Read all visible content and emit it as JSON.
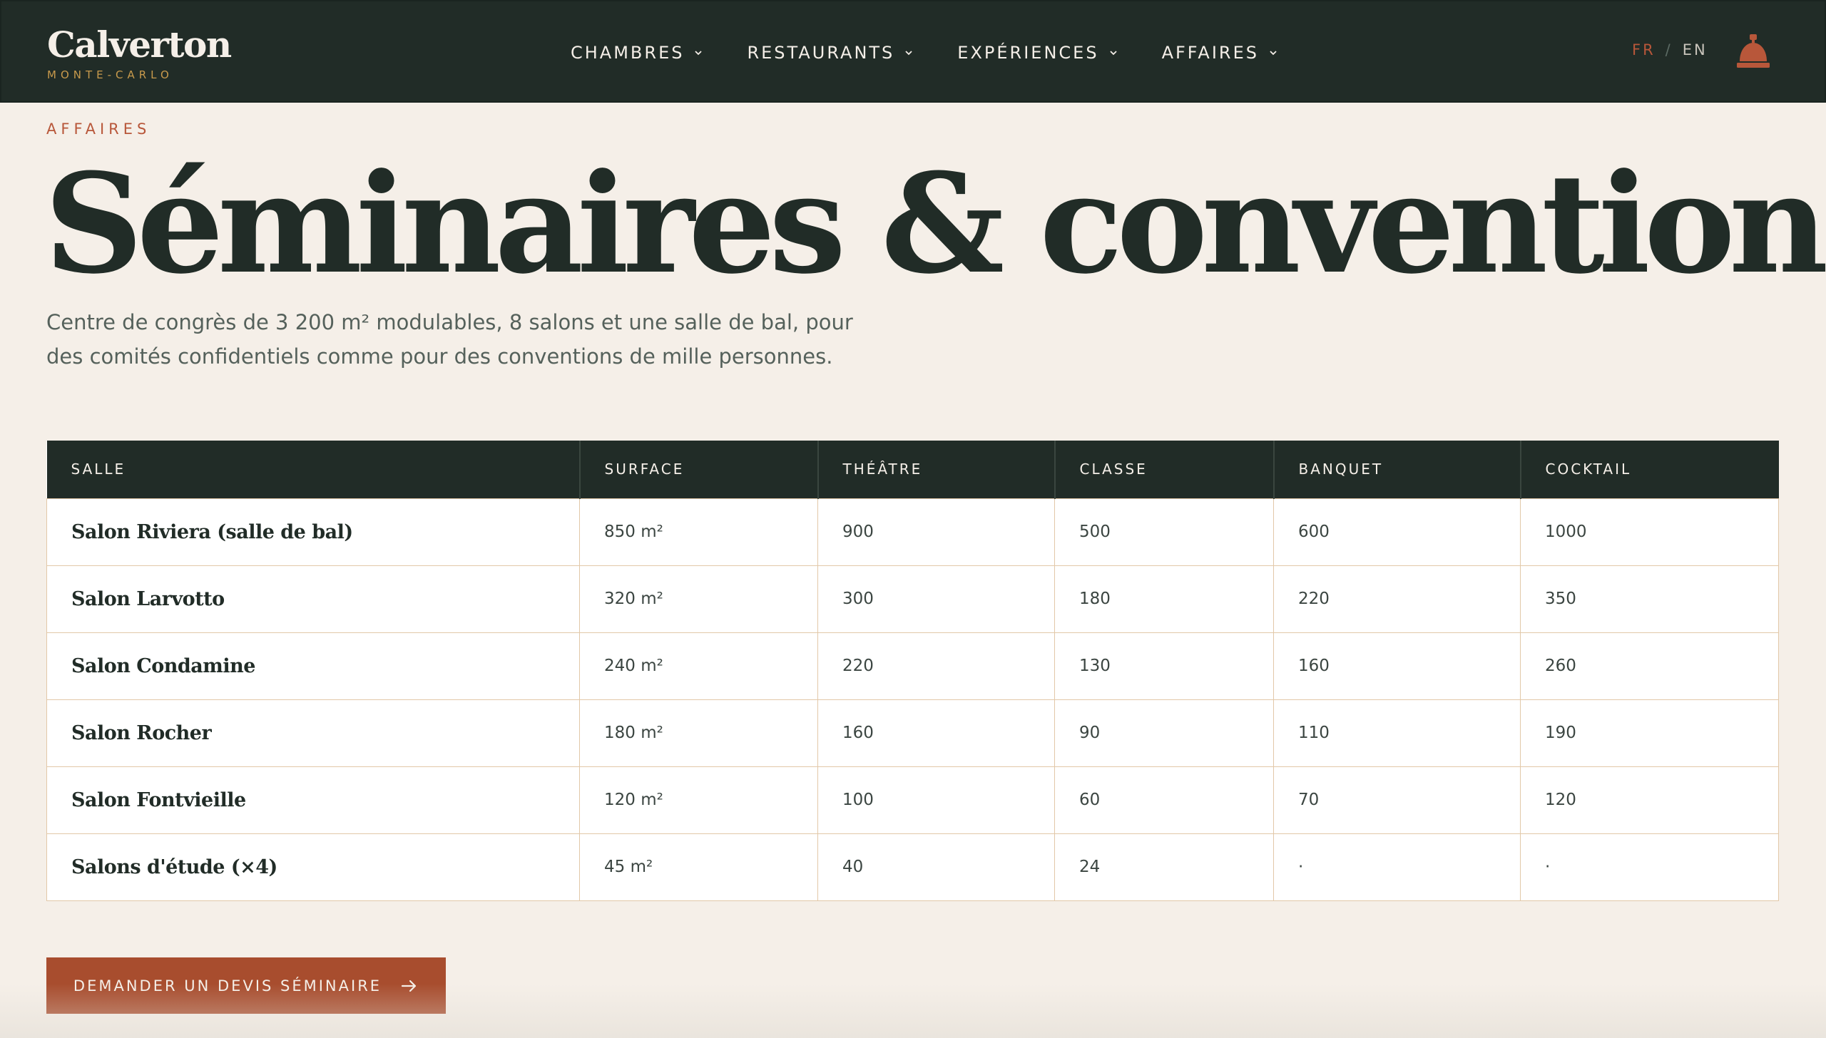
{
  "brand": {
    "name": "Calverton",
    "subtitle": "MONTE-CARLO"
  },
  "nav": {
    "items": [
      {
        "label": "CHAMBRES"
      },
      {
        "label": "RESTAURANTS"
      },
      {
        "label": "EXPÉRIENCES"
      },
      {
        "label": "AFFAIRES"
      }
    ],
    "chevron_icon": "chevron-down-icon"
  },
  "language": {
    "fr": "FR",
    "separator": "/",
    "en": "EN",
    "active": "FR"
  },
  "concierge_icon": "reception-bell-icon",
  "colors": {
    "header_bg": "#212c27",
    "page_bg": "#f5efe8",
    "accent": "#b8573a",
    "gold": "#c89a4c",
    "cta_bg": "#a84d2e",
    "table_border": "#e2c8a8"
  },
  "hero": {
    "eyebrow": "AFFAIRES",
    "title": "Séminaires & conventions",
    "lead": "Centre de congrès de 3 200 m² modulables, 8 salons et une salle de bal, pour des comités confidentiels comme pour des conventions de mille personnes."
  },
  "table": {
    "headers": [
      "SALLE",
      "SURFACE",
      "THÉÂTRE",
      "CLASSE",
      "BANQUET",
      "COCKTAIL"
    ],
    "rows": [
      [
        "Salon Riviera (salle de bal)",
        "850 m²",
        "900",
        "500",
        "600",
        "1000"
      ],
      [
        "Salon Larvotto",
        "320 m²",
        "300",
        "180",
        "220",
        "350"
      ],
      [
        "Salon Condamine",
        "240 m²",
        "220",
        "130",
        "160",
        "260"
      ],
      [
        "Salon Rocher",
        "180 m²",
        "160",
        "90",
        "110",
        "190"
      ],
      [
        "Salon Fontvieille",
        "120 m²",
        "100",
        "60",
        "70",
        "120"
      ],
      [
        "Salons d'étude (×4)",
        "45 m²",
        "40",
        "24",
        "·",
        "·"
      ]
    ]
  },
  "cta": {
    "label": "DEMANDER UN DEVIS SÉMINAIRE",
    "icon": "arrow-right-icon"
  }
}
